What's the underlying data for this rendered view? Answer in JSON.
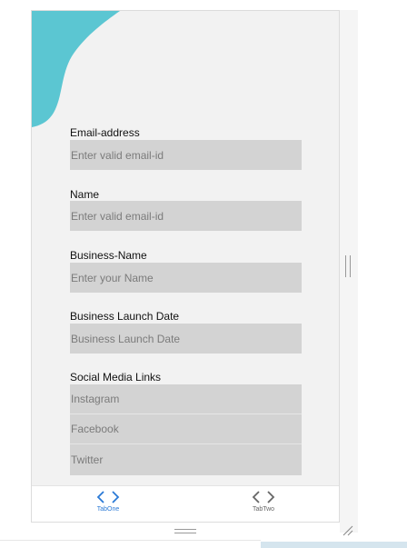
{
  "colors": {
    "accent_blob": "#5bc6d2",
    "input_bg": "#d3d3d3",
    "active_tab": "#2a79d6",
    "inactive_tab": "#666666"
  },
  "form": {
    "email": {
      "label": "Email-address",
      "placeholder": "Enter valid email-id"
    },
    "name": {
      "label": "Name",
      "placeholder": "Enter valid email-id"
    },
    "business_name": {
      "label": "Business-Name",
      "placeholder": "Enter your Name"
    },
    "launch_date": {
      "label": "Business Launch Date",
      "placeholder": "Business Launch Date"
    },
    "social": {
      "label": "Social Media Links",
      "instagram_placeholder": "Instagram",
      "facebook_placeholder": "Facebook",
      "twitter_placeholder": "Twitter"
    }
  },
  "tabs": [
    {
      "label": "TabOne",
      "icon": "code-icon",
      "active": true
    },
    {
      "label": "TabTwo",
      "icon": "code-icon",
      "active": false
    }
  ]
}
